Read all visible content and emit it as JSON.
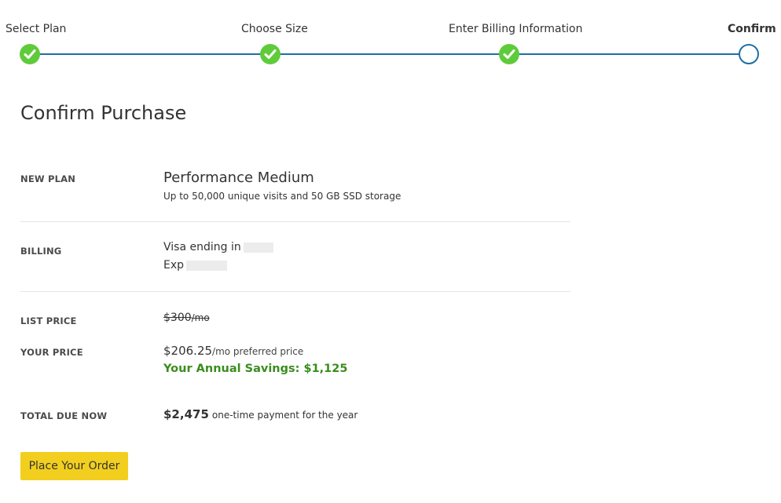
{
  "stepper": {
    "steps": [
      {
        "label": "Select Plan",
        "status": "complete"
      },
      {
        "label": "Choose Size",
        "status": "complete"
      },
      {
        "label": "Enter Billing Information",
        "status": "complete"
      },
      {
        "label": "Confirm",
        "status": "current"
      }
    ],
    "colors": {
      "complete": "#5fcb3a",
      "line": "#1d6fa5"
    }
  },
  "page": {
    "title": "Confirm Purchase"
  },
  "summary": {
    "new_plan": {
      "label": "NEW PLAN",
      "name": "Performance Medium",
      "description": "Up to 50,000 unique visits and 50 GB SSD storage"
    },
    "billing": {
      "label": "BILLING",
      "card_text": "Visa ending in",
      "exp_text": "Exp"
    },
    "list_price": {
      "label": "LIST PRICE",
      "amount": "$300",
      "period": "/mo"
    },
    "your_price": {
      "label": "YOUR PRICE",
      "amount": "$206.25",
      "note": "/mo preferred price",
      "savings": "Your Annual Savings: $1,125"
    },
    "total_due": {
      "label": "TOTAL DUE NOW",
      "amount": "$2,475",
      "note": "one-time payment for the year"
    }
  },
  "actions": {
    "place_order_label": "Place Your Order",
    "button_color": "#f2cf1e"
  },
  "icons": {
    "complete_step": "checkmark-icon",
    "current_step": "empty-circle-icon"
  }
}
